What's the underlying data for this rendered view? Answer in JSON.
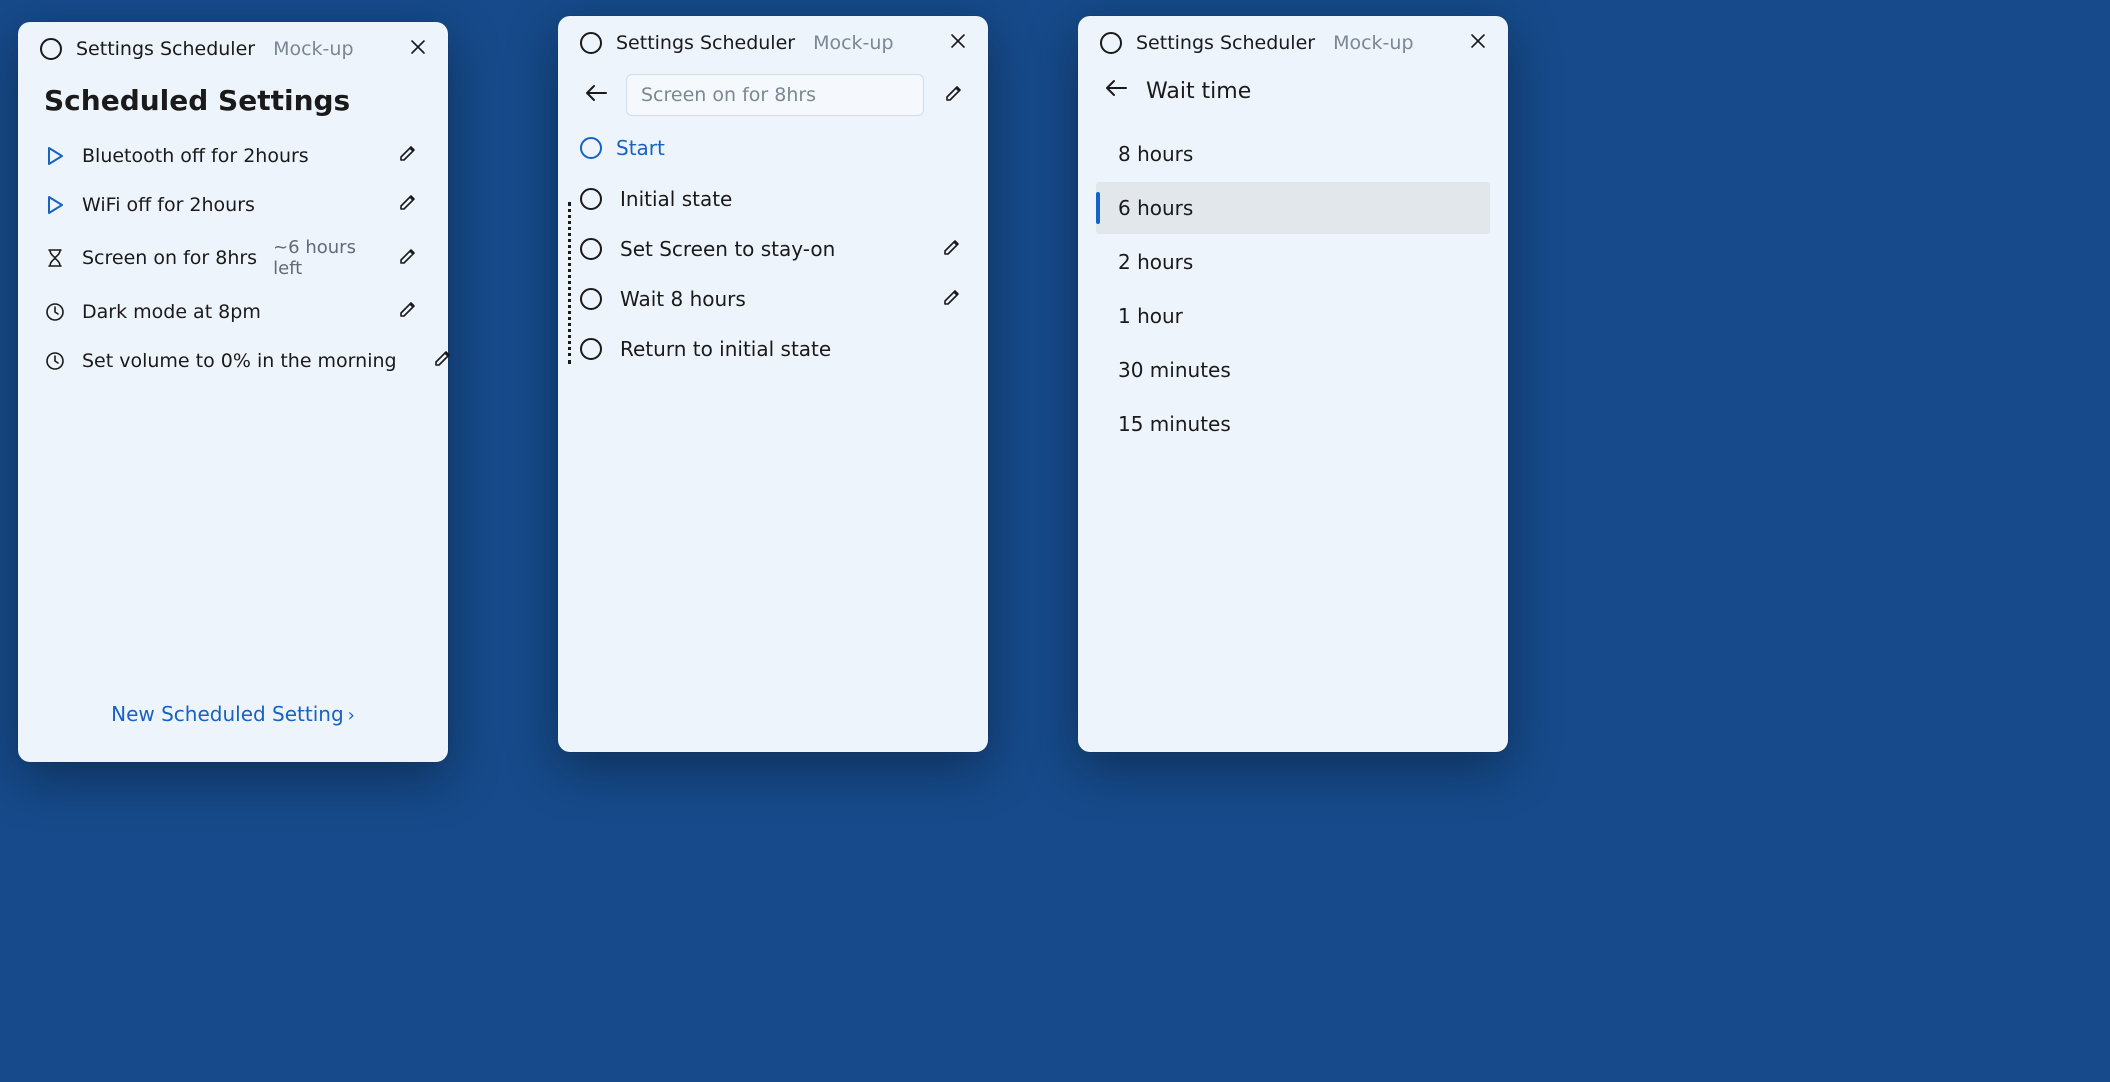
{
  "app": {
    "title": "Settings Scheduler",
    "tag": "Mock-up"
  },
  "w1": {
    "heading": "Scheduled Settings",
    "items": [
      {
        "icon": "play",
        "label": "Bluetooth off for 2hours",
        "meta": ""
      },
      {
        "icon": "play",
        "label": "WiFi off for 2hours",
        "meta": ""
      },
      {
        "icon": "timer",
        "label": "Screen on for 8hrs",
        "meta": "~6 hours left"
      },
      {
        "icon": "clock",
        "label": "Dark mode at  8pm",
        "meta": ""
      },
      {
        "icon": "clock",
        "label": "Set volume to 0% in the morning",
        "meta": ""
      }
    ],
    "new_link": "New Scheduled Setting"
  },
  "w2": {
    "name_placeholder": "Screen on for 8hrs",
    "start_label": "Start",
    "steps": [
      {
        "label": "Initial state",
        "editable": false
      },
      {
        "label": "Set Screen to stay-on",
        "editable": true
      },
      {
        "label": "Wait 8 hours",
        "editable": true
      },
      {
        "label": "Return to initial state",
        "editable": false
      }
    ]
  },
  "w3": {
    "heading": "Wait time",
    "options": [
      {
        "label": "8 hours",
        "selected": false
      },
      {
        "label": "6 hours",
        "selected": true
      },
      {
        "label": "2 hours",
        "selected": false
      },
      {
        "label": "1 hour",
        "selected": false
      },
      {
        "label": "30 minutes",
        "selected": false
      },
      {
        "label": "15 minutes",
        "selected": false
      }
    ]
  }
}
